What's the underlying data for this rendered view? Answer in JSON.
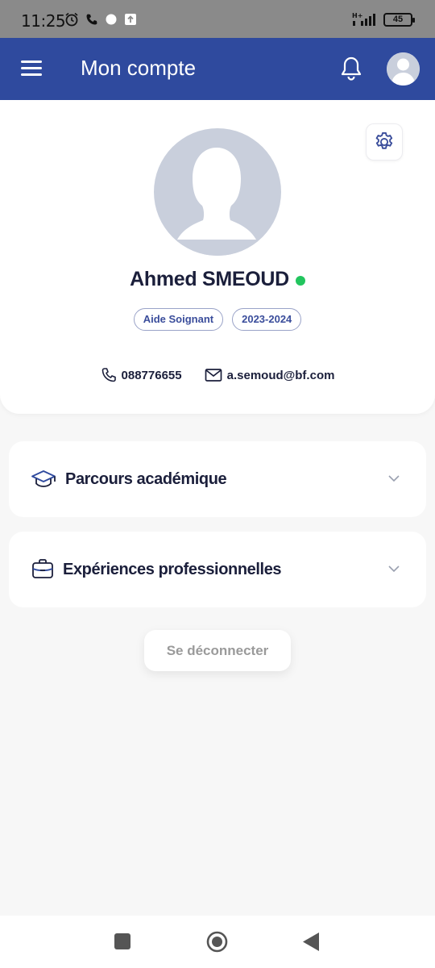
{
  "status_bar": {
    "time": "11:25",
    "network": "H+",
    "battery": "45"
  },
  "app_bar": {
    "title": "Mon compte"
  },
  "profile": {
    "name": "Ahmed SMEOUD",
    "online": true,
    "badges": [
      "Aide Soignant",
      "2023-2024"
    ],
    "phone": "088776655",
    "email": "a.semoud@bf.com"
  },
  "sections": [
    {
      "label": "Parcours académique",
      "icon": "graduation-cap-icon"
    },
    {
      "label": "Expériences professionnelles",
      "icon": "briefcase-icon"
    }
  ],
  "logout_label": "Se déconnecter",
  "colors": {
    "primary": "#2f4a9e",
    "online": "#22c55e",
    "text": "#1b1f3b",
    "badge_text": "#3a4d9b"
  }
}
